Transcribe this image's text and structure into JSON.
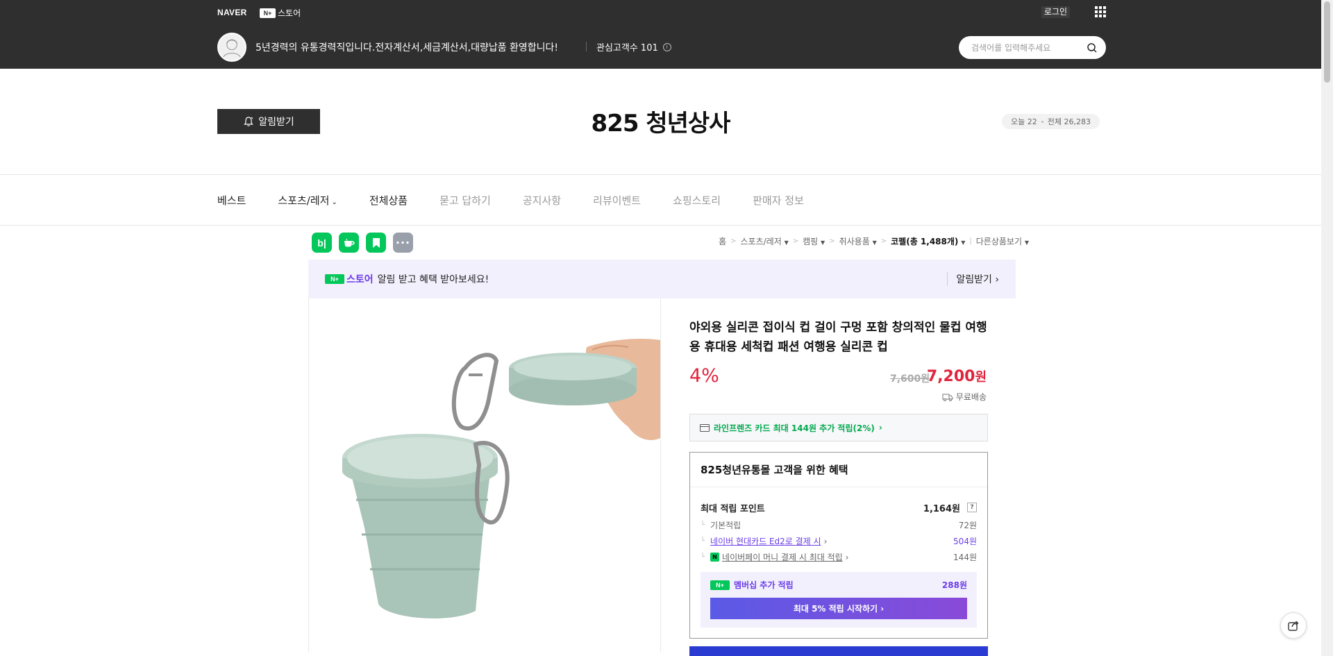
{
  "header": {
    "naver_logo": "NAVER",
    "nplus_badge": "N+",
    "store_link": "스토어",
    "login": "로그인",
    "store_description": "5년경력의 유통경력직입니다.전자계산서,세금계산서,대량납품 환영합니다!",
    "followers": "관심고객수 101",
    "search_placeholder": "검색어를 입력해주세요"
  },
  "store": {
    "alarm_button": "알림받기",
    "name": "825 청년상사",
    "today_visits": "오늘 22",
    "total_visits": "전체 26,283"
  },
  "nav": {
    "items": [
      "베스트",
      "스포츠/레저",
      "전체상품",
      "묻고 답하기",
      "공지사항",
      "리뷰이벤트",
      "쇼핑스토리",
      "판매자 정보"
    ]
  },
  "share": {
    "blog": "b|",
    "more": "···"
  },
  "breadcrumb": {
    "home": "홈",
    "cat1": "스포츠/레저",
    "cat2": "캠핑",
    "cat3": "취사용품",
    "cat4": "코펠(총 1,488개)",
    "other": "다른상품보기"
  },
  "notice": {
    "badge": "N+",
    "brand": "스토어",
    "message": "알림 받고 혜택 받아보세요!",
    "action": "알림받기"
  },
  "product": {
    "title": "야외용 실리콘 접이식 컵 걸이 구멍 포함 창의적인 물컵 여행용 휴대용 세척컵 패션 여행용 실리콘 컵",
    "discount": "4%",
    "original_price": "7,600원",
    "sale_price": "7,200",
    "sale_unit": "원",
    "shipping": "무료배송",
    "card_benefit": "라인프렌즈 카드 최대 144원 추가 적립(2%)"
  },
  "benefits": {
    "title": "825청년유통몰 고객을 위한 혜택",
    "max_points_label": "최대 적립 포인트",
    "max_points_value": "1,164원",
    "basic_label": "기본적립",
    "basic_value": "72원",
    "hyundai_label": "네이버 현대카드 Ed2로 결제 시",
    "hyundai_value": "504원",
    "npay_label": "네이버페이 머니 결제 시 최대 적립",
    "npay_value": "144원",
    "membership_label": "멤버십 추가 적립",
    "membership_value": "288원",
    "membership_cta": "최대 5% 적립 시작하기"
  },
  "colors": {
    "header_bg": "#2f2f2f",
    "accent_red": "#e0243c",
    "naver_green": "#03c75a",
    "purple": "#6a3de8"
  }
}
